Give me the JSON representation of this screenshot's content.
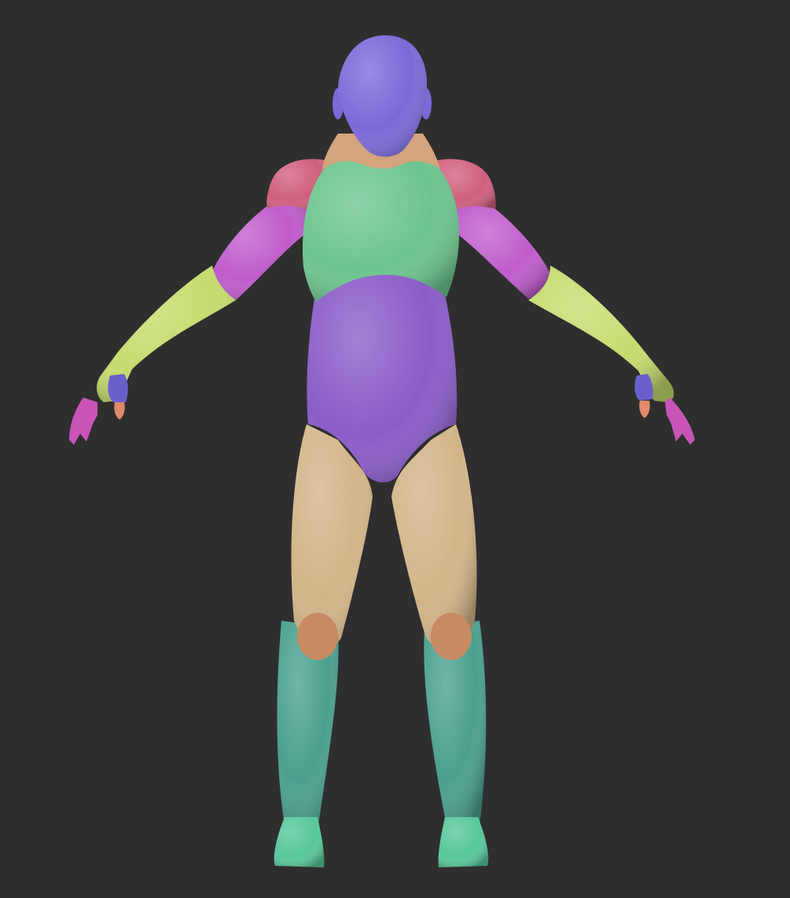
{
  "viewport": {
    "background_color": "#2e2e2e"
  },
  "model": {
    "pose": "A-pose",
    "view": "front",
    "polygroup_colors": {
      "head": "#7a6ad8",
      "neck": "#d4a47e",
      "shoulder_caps": "#d0607e",
      "chest": "#6cc58e",
      "abdomen_pelvis": "#8a5cc8",
      "upper_arms": "#c05ccc",
      "forearms": "#c4dc6e",
      "hand_back": "#6a60cc",
      "fingers": "#c854b8",
      "thumbs": "#e08a6c",
      "thighs": "#d2b488",
      "knees": "#c88a62",
      "shins": "#4aa08e",
      "feet": "#58c89a"
    }
  }
}
